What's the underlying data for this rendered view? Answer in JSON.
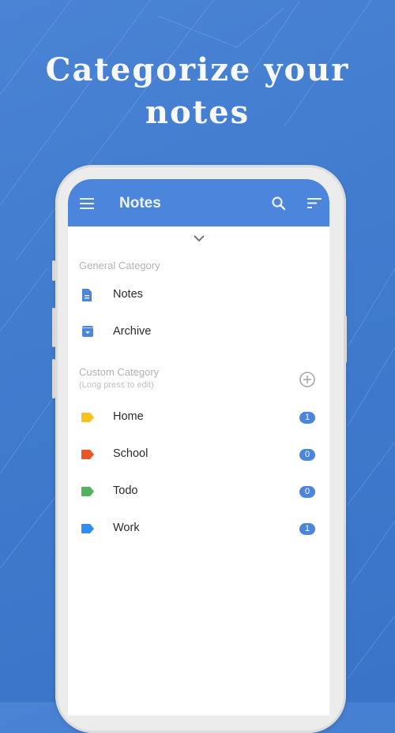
{
  "promo": {
    "headline_line1": "Categorize your",
    "headline_line2": "notes"
  },
  "appbar": {
    "title": "Notes",
    "icons": [
      "menu-icon",
      "search-icon",
      "sort-icon"
    ]
  },
  "general_category": {
    "label": "General Category",
    "items": [
      {
        "label": "Notes",
        "icon": "note-document-icon",
        "color": "#4b86dc"
      },
      {
        "label": "Archive",
        "icon": "archive-icon",
        "color": "#4b86dc"
      }
    ]
  },
  "custom_category": {
    "label": "Custom Category",
    "hint": "(Long press to edit)",
    "add_icon": "add-circle-icon",
    "items": [
      {
        "label": "Home",
        "color": "#f5c31b",
        "count": "1"
      },
      {
        "label": "School",
        "color": "#e8562a",
        "count": "0"
      },
      {
        "label": "Todo",
        "color": "#55b15a",
        "count": "0"
      },
      {
        "label": "Work",
        "color": "#2f8ff0",
        "count": "1"
      }
    ]
  }
}
